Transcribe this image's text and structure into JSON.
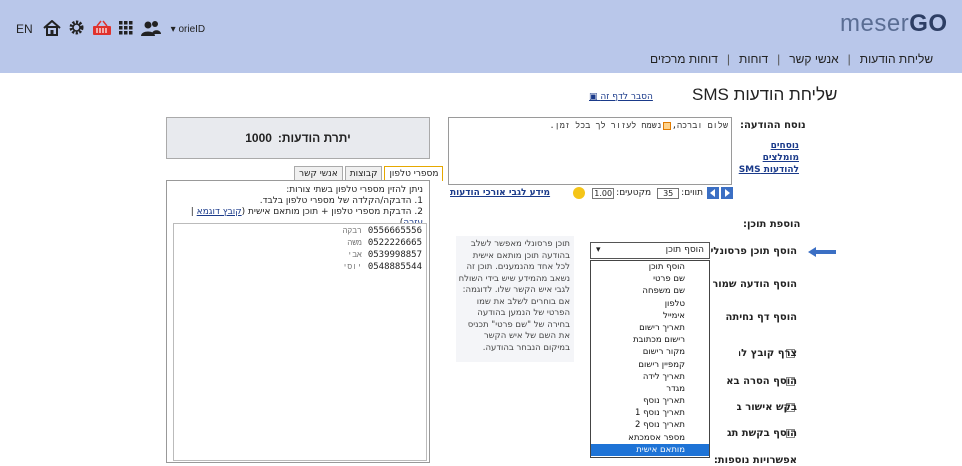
{
  "header": {
    "logo_light": "meser",
    "logo_bold": "GO",
    "nav": [
      "שליחת הודעות",
      "אנשי קשר",
      "דוחות",
      "דוחות מרכזים"
    ],
    "lang": "EN",
    "user": "▾ orieID",
    "icons": [
      "home-icon",
      "gear-icon",
      "basket-icon",
      "apps-grid-icon",
      "users-icon"
    ]
  },
  "page": {
    "title": "שליחת הודעות SMS",
    "explain_link": "הסבר לדף זה"
  },
  "message": {
    "label": "נוסח ההודעה:",
    "recommended_link": "נוסחים מומלצים להודעות SMS",
    "text_before": "שלום וברכה,",
    "text_after": "נשמח לעזור לך בכל זמן.",
    "chars_label": "תווים:",
    "chars_value": "35",
    "segments_label": "מקטעים:",
    "segments_value": "1.00",
    "length_info_link": "מידע לגבי אורכי הודעות"
  },
  "add_content": {
    "title": "הוספת תוכן:",
    "personal_label": "הוסף תוכן פרסונלי",
    "saved_label": "הוסף הודעה שמורה",
    "landing_label": "הוסף דף נחיתה",
    "attach_label": "צרף קובץ להודעה",
    "unsubscribe_label": "הוסף הסרה באמצעות",
    "confirm_label": "בקש אישור בקליטה",
    "reply_label": "הוסף בקשת תגובה",
    "more_label": "אפשרויות נוספות:",
    "select_value": "הוסף תוכן",
    "dropdown_options": [
      "הוסף תוכן",
      "שם פרטי",
      "שם משפחה",
      "טלפון",
      "אימייל",
      "תאריך רישום",
      "רישום מכתובת",
      "מקור רישום",
      "קמפיין רישום",
      "תאריך לידה",
      "מגדר",
      "תאריך נוסף",
      "תאריך נוסף 1",
      "תאריך נוסף 2",
      "מספר אסמכתא",
      "מותאם אישית"
    ],
    "selected_option": "מותאם אישית",
    "hint": "תוכן פרסונלי מאפשר לשלב בהודעה תוכן מותאם אישית לכל אחד מהנמענים. תוכן זה נשאב מהמידע שיש בידי השולח לגבי איש הקשר שלו. לדוגמה: אם בוחרים לשלב את שמו הפרטי של הנמען בהודעה בחירה של \"שם פרטי\" תכניס את השם של איש הקשר במיקום הנבחר בהודעה."
  },
  "credit": {
    "label": "יתרת הודעות:",
    "value": "1000"
  },
  "recipients": {
    "tabs": [
      "מספרי טלפון",
      "קבוצות",
      "אנשי קשר"
    ],
    "active_tab": "מספרי טלפון",
    "instr_1": "ניתן להזין מספרי טלפון בשתי צורות:",
    "instr_2": "1. הדבקה/הקלדה של מספרי טלפון בלבד.",
    "instr_3": "2. הדבקת מספרי טלפון + תוכן מותאם אישית",
    "sample_link": "קובץ דוגמא",
    "help_link": "עזרה",
    "phones": [
      {
        "number": "0556665556",
        "name": "רבקה"
      },
      {
        "number": "0522226665",
        "name": "משה"
      },
      {
        "number": "0539998857",
        "name": "אבי"
      },
      {
        "number": "0548885544",
        "name": "יוסי"
      }
    ]
  },
  "colors": {
    "header_bg": "#b9c7ea",
    "link": "#1a3a8a",
    "selected": "#1e73d6",
    "arrow": "#3b6fc4",
    "basket": "#e0312c"
  }
}
